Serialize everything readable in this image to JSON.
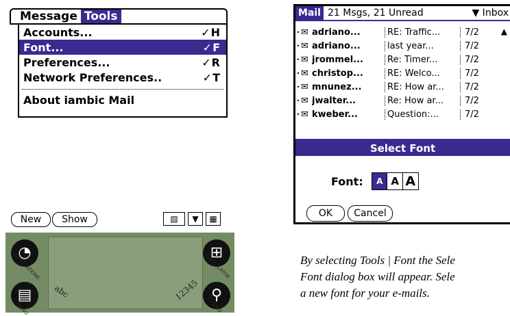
{
  "left": {
    "menubar": {
      "items": [
        {
          "label": "Message",
          "selected": false
        },
        {
          "label": "Tools",
          "selected": true
        }
      ]
    },
    "menu_items": [
      {
        "label": "Accounts...",
        "shortcut": "✓H",
        "selected": false
      },
      {
        "label": "Font...",
        "shortcut": "✓F",
        "selected": true
      },
      {
        "label": "Preferences...",
        "shortcut": "✓R",
        "selected": false
      },
      {
        "label": "Network Preferences..",
        "shortcut": "✓T",
        "selected": false
      }
    ],
    "about_label": "About iambic Mail",
    "new_label": "New",
    "show_label": "Show",
    "silk": {
      "applications": "APPLICATIONS",
      "menu": "MENU",
      "calculator": "CALCULATOR",
      "find": "FIND",
      "abc": "abc",
      "digits": "12345"
    }
  },
  "right": {
    "app_tab": "Mail",
    "msg_count": "21 Msgs, 21 Unread",
    "folder": "▼ Inbox",
    "messages": [
      {
        "from": "adriano...",
        "subject": "RE: Traffic...",
        "date": "7/2"
      },
      {
        "from": "adriano...",
        "subject": "last year...",
        "date": "7/2"
      },
      {
        "from": "jrommel...",
        "subject": "Re: Timer...",
        "date": "7/2"
      },
      {
        "from": "christop...",
        "subject": "RE: Welco...",
        "date": "7/2"
      },
      {
        "from": "mnunez...",
        "subject": "RE: How ar...",
        "date": "7/2"
      },
      {
        "from": "jwalter...",
        "subject": "Re: How ar...",
        "date": "7/2"
      },
      {
        "from": "kweber...",
        "subject": "Question:...",
        "date": "7/2"
      }
    ],
    "dialog": {
      "title": "Select Font",
      "font_label": "Font:",
      "font_options": [
        "A",
        "A",
        "A"
      ],
      "selected_font": 0,
      "ok": "OK",
      "cancel": "Cancel"
    }
  },
  "caption": {
    "line1": "By selecting Tools | Font the Sele",
    "line2": "Font dialog box will appear. Sele",
    "line3": "a new font for your e-mails."
  },
  "colors": {
    "selection": "#3b2a8f",
    "silkscreen": "#748c64"
  }
}
